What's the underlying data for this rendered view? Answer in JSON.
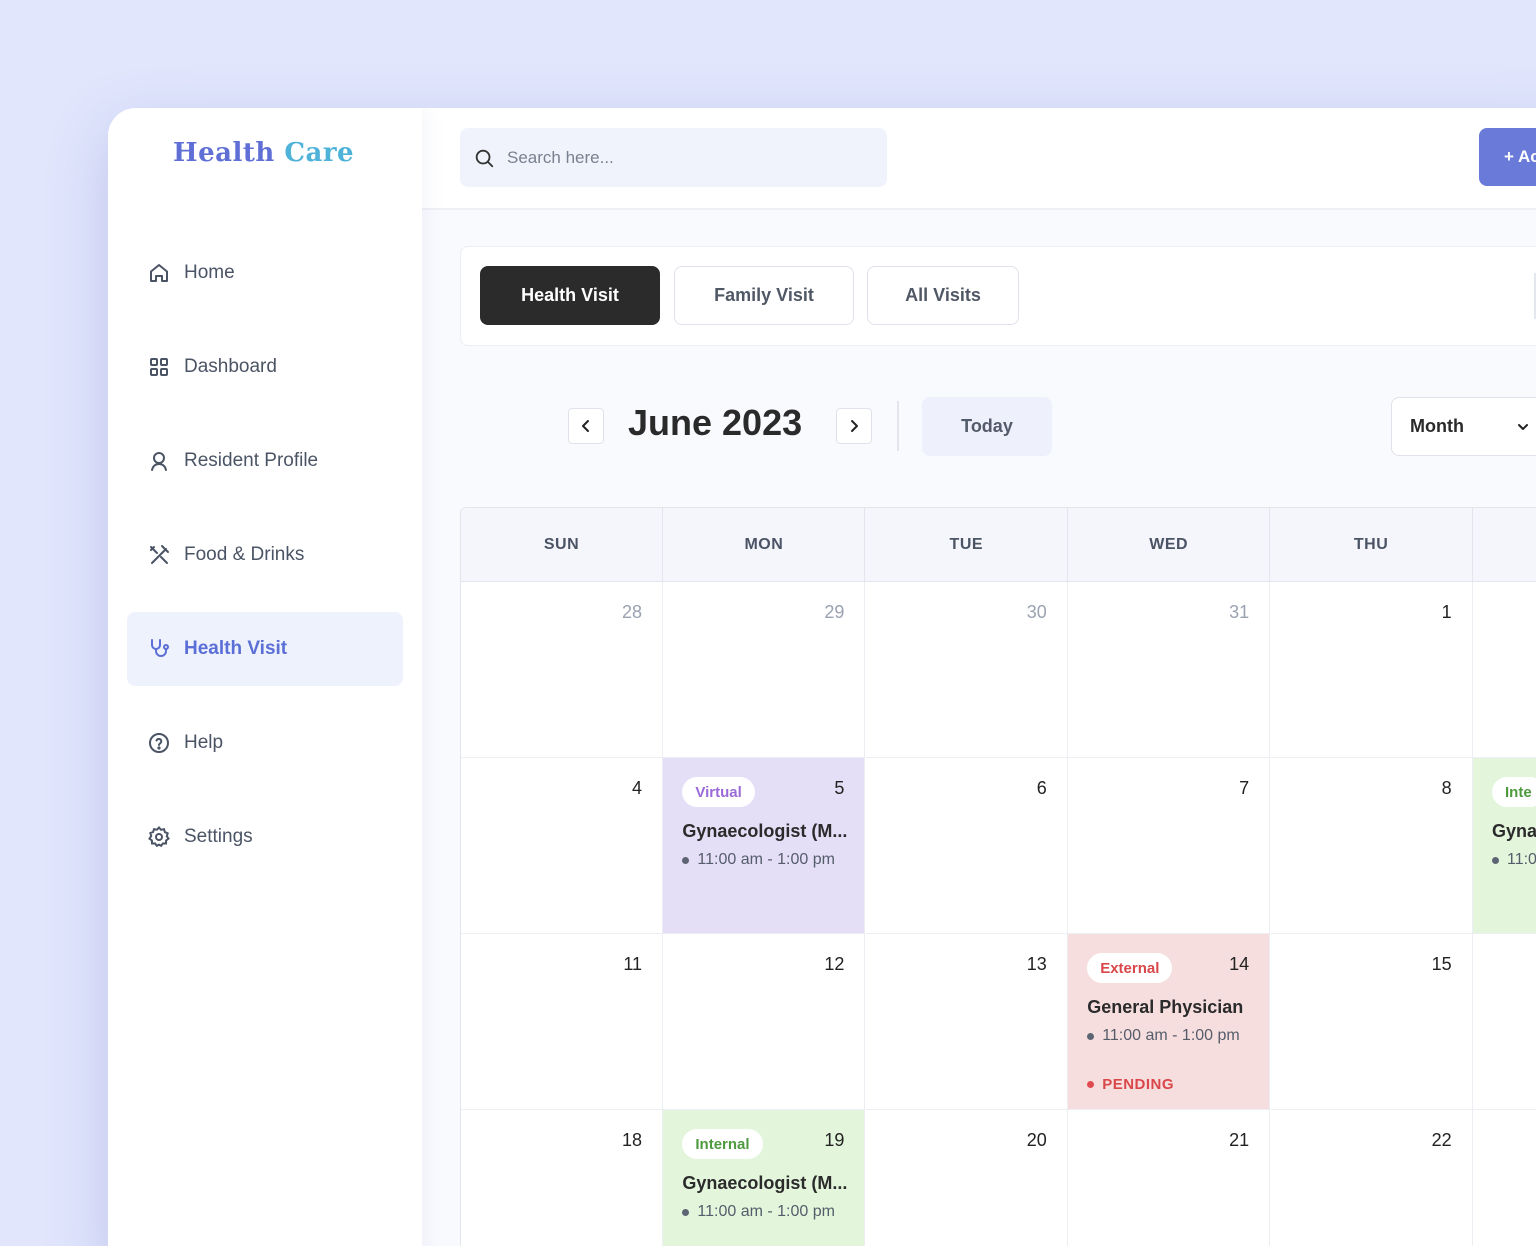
{
  "app": {
    "logo_word1": "Health",
    "logo_word2": "Care"
  },
  "sidebar": {
    "items": [
      {
        "label": "Home",
        "icon": "home-icon"
      },
      {
        "label": "Dashboard",
        "icon": "grid-icon"
      },
      {
        "label": "Resident Profile",
        "icon": "user-icon"
      },
      {
        "label": "Food & Drinks",
        "icon": "utensils-icon"
      },
      {
        "label": "Health Visit",
        "icon": "stethoscope-icon",
        "active": true
      },
      {
        "label": "Help",
        "icon": "help-circle-icon"
      },
      {
        "label": "Settings",
        "icon": "gear-icon"
      }
    ]
  },
  "topbar": {
    "search_placeholder": "Search here...",
    "add_button": "+ Ac"
  },
  "tabs": [
    {
      "label": "Health Visit",
      "active": true
    },
    {
      "label": "Family Visit"
    },
    {
      "label": "All Visits"
    }
  ],
  "calendar": {
    "month_title": "June 2023",
    "today_label": "Today",
    "view_label": "Month",
    "day_names": [
      "SUN",
      "MON",
      "TUE",
      "WED",
      "THU",
      ""
    ],
    "weeks": [
      [
        {
          "day": "28",
          "muted": true
        },
        {
          "day": "29",
          "muted": true
        },
        {
          "day": "30",
          "muted": true
        },
        {
          "day": "31",
          "muted": true
        },
        {
          "day": "1"
        },
        {
          "day": ""
        }
      ],
      [
        {
          "day": "4"
        },
        {
          "day": "5",
          "event": {
            "type": "virtual",
            "badge": "Virtual",
            "title": "Gynaecologist (M...",
            "time": "11:00 am - 1:00 pm"
          }
        },
        {
          "day": "6"
        },
        {
          "day": "7"
        },
        {
          "day": "8"
        },
        {
          "day": "",
          "event": {
            "type": "internal",
            "badge": "Inte",
            "title": "Gyna",
            "time": "11:0"
          }
        }
      ],
      [
        {
          "day": "11"
        },
        {
          "day": "12"
        },
        {
          "day": "13"
        },
        {
          "day": "14",
          "event": {
            "type": "external",
            "badge": "External",
            "title": "General Physician",
            "time": "11:00 am - 1:00 pm",
            "status": "PENDING"
          }
        },
        {
          "day": "15"
        },
        {
          "day": ""
        }
      ],
      [
        {
          "day": "18"
        },
        {
          "day": "19",
          "event": {
            "type": "internal",
            "badge": "Internal",
            "title": "Gynaecologist (M...",
            "time": "11:00 am - 1:00 pm"
          }
        },
        {
          "day": "20"
        },
        {
          "day": "21"
        },
        {
          "day": "22"
        },
        {
          "day": ""
        }
      ]
    ]
  },
  "colors": {
    "accent": "#6a7ad8",
    "active_tab": "#2b2b2b",
    "virtual_bg": "#e5def7",
    "external_bg": "#f7dede",
    "internal_bg": "#e3f6dc"
  }
}
